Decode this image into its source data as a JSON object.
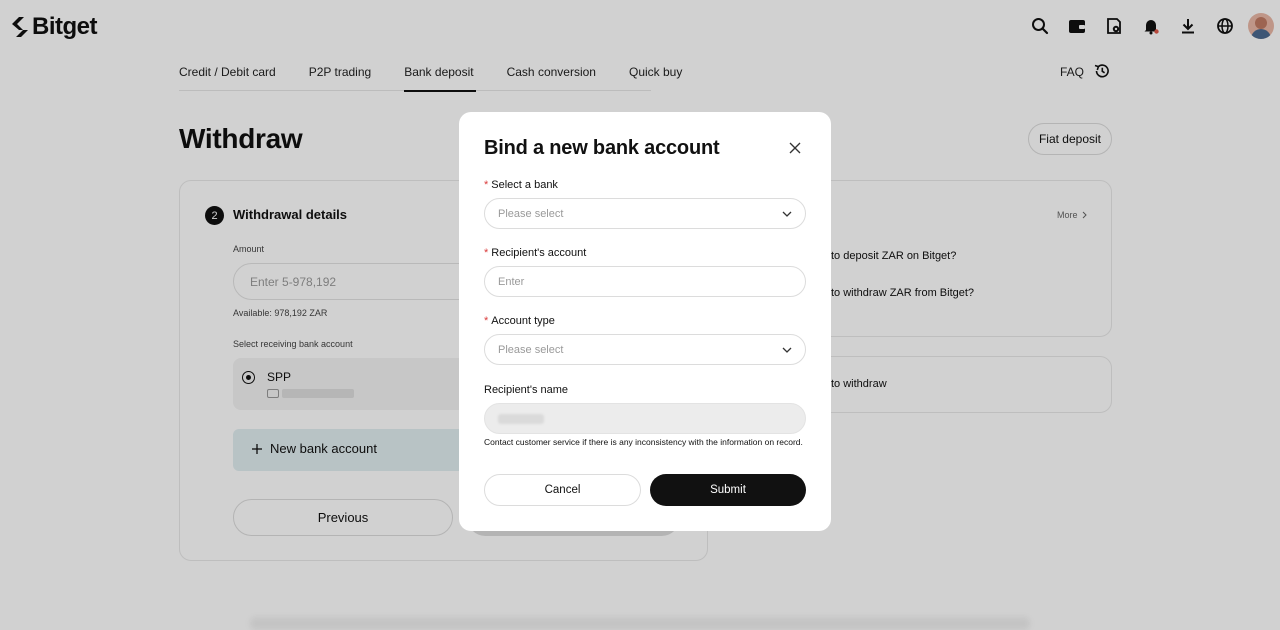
{
  "brand": {
    "name": "Bitget"
  },
  "header_icons": [
    "search-icon",
    "wallet-icon",
    "orders-icon",
    "bell-icon",
    "download-icon",
    "globe-icon"
  ],
  "tabs": [
    {
      "label": "Credit / Debit card"
    },
    {
      "label": "P2P trading"
    },
    {
      "label": "Bank deposit",
      "active": true
    },
    {
      "label": "Cash conversion"
    },
    {
      "label": "Quick buy"
    }
  ],
  "faq_label": "FAQ",
  "page": {
    "title": "Withdraw",
    "fiat_deposit_label": "Fiat deposit"
  },
  "withdrawal": {
    "step": "2",
    "section_title": "Withdrawal details",
    "amount_label": "Amount",
    "amount_placeholder": "Enter 5-978,192",
    "available": "Available: 978,192 ZAR",
    "select_account_label": "Select receiving bank account",
    "account_name": "SPP",
    "new_account_label": "New bank account",
    "previous_label": "Previous"
  },
  "faq_panel": {
    "more_label": "More",
    "items": [
      "w to deposit ZAR on Bitget?",
      "w to withdraw ZAR from Bitget?"
    ],
    "tutorial": "w to withdraw"
  },
  "modal": {
    "title": "Bind a new bank account",
    "fields": {
      "bank": {
        "label": "Select a bank",
        "placeholder": "Please select",
        "required": true
      },
      "account": {
        "label": "Recipient's account",
        "placeholder": "Enter",
        "required": true
      },
      "type": {
        "label": "Account type",
        "placeholder": "Please select",
        "required": true
      },
      "name": {
        "label": "Recipient's name",
        "required": false
      }
    },
    "required_marker": "*",
    "notice": "Contact customer service if there is any inconsistency with the information on record.",
    "cancel_label": "Cancel",
    "submit_label": "Submit"
  },
  "colors": {
    "accent_bg": "#e1eef1",
    "primary_button": "#111111",
    "required": "#d93b3b"
  }
}
